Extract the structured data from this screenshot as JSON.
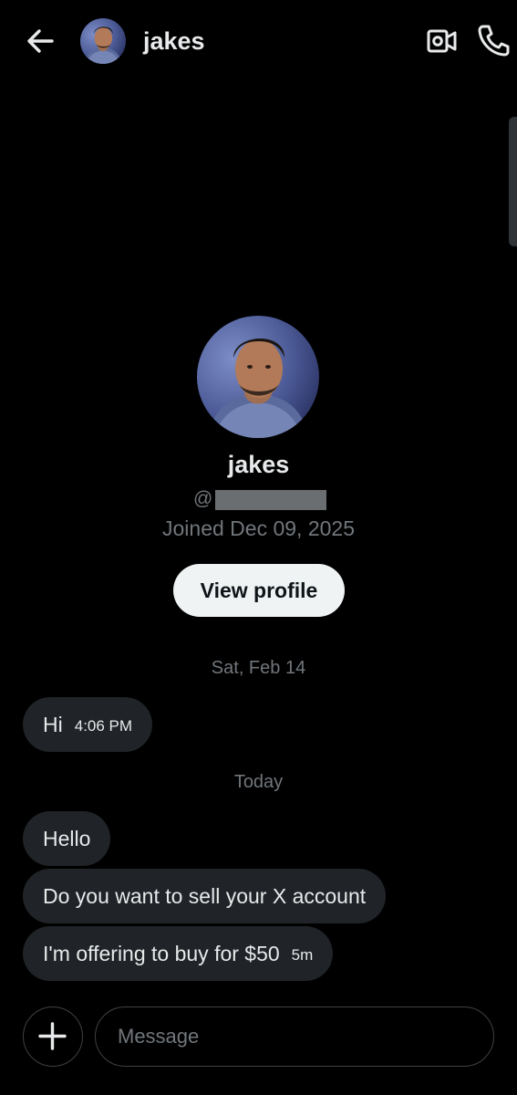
{
  "header": {
    "contact_name": "jakes"
  },
  "profile": {
    "name": "jakes",
    "handle_prefix": "@",
    "joined": "Joined Dec 09, 2025",
    "view_profile_label": "View profile"
  },
  "conversation": {
    "groups": [
      {
        "date_label": "Sat, Feb 14",
        "messages": [
          {
            "text": "Hi",
            "time": "4:06 PM"
          }
        ]
      },
      {
        "date_label": "Today",
        "messages": [
          {
            "text": "Hello",
            "time": ""
          },
          {
            "text": "Do you want to sell your X account",
            "time": ""
          },
          {
            "text": "I'm offering to buy for $50",
            "time": "5m"
          }
        ]
      }
    ]
  },
  "composer": {
    "placeholder": "Message"
  },
  "icons": {
    "back": "arrow-left-icon",
    "video": "video-camera-icon",
    "call": "phone-icon",
    "add": "plus-icon"
  },
  "colors": {
    "background": "#000000",
    "bubble": "#202327",
    "text_primary": "#e7e9ea",
    "text_secondary": "#71767b",
    "button_light": "#eff3f4"
  }
}
